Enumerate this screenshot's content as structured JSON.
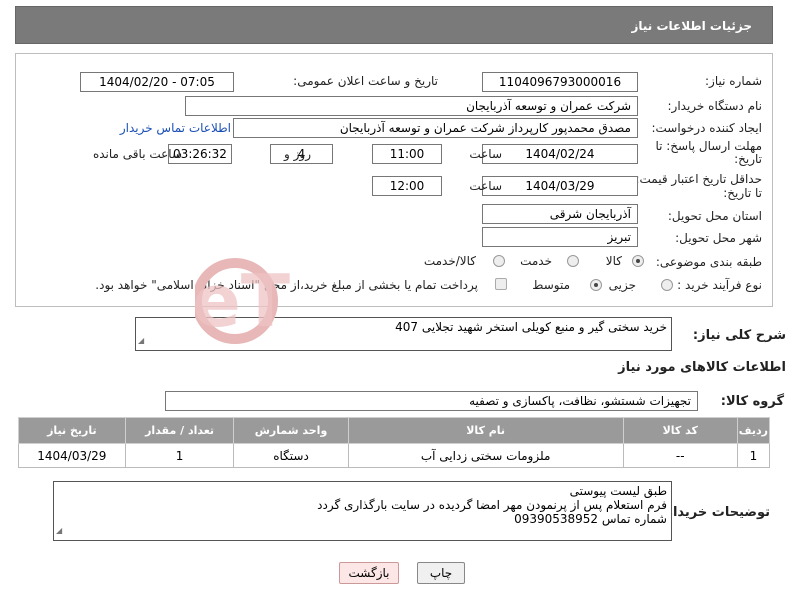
{
  "page_title": "جزئیات اطلاعات نیاز",
  "fields": {
    "need_number_label": "شماره نیاز:",
    "need_number": "1104096793000016",
    "announce_datetime_label": "تاریخ و ساعت اعلان عمومی:",
    "announce_datetime": "1404/02/20 - 07:05",
    "buyer_org_label": "نام دستگاه خریدار:",
    "buyer_org": "شرکت عمران و توسعه آذربایجان",
    "requester_label": "ایجاد کننده درخواست:",
    "requester": "مصدق محمدپور کارپرداز شرکت عمران و توسعه آذربایجان",
    "buyer_contact_link": "اطلاعات تماس خریدار",
    "deadline_label_1": "مهلت ارسال پاسخ: تا",
    "deadline_label_2": "تاریخ:",
    "deadline_date": "1404/02/24",
    "time_word": "ساعت",
    "deadline_time": "11:00",
    "days_remaining": "4",
    "days_word": "روز و",
    "time_remaining": "03:26:32",
    "time_remaining_suffix": "ساعت باقی مانده",
    "validity_label_1": "حداقل تاریخ اعتبار قیمت:",
    "validity_label_2": "تا تاریخ:",
    "validity_date": "1404/03/29",
    "validity_time": "12:00",
    "province_label": "استان محل تحویل:",
    "province": "آذربایجان شرقی",
    "city_label": "شهر محل تحویل:",
    "city": "تبریز",
    "category_label": "طبقه بندی موضوعی:",
    "category_options": [
      "کالا",
      "خدمت",
      "کالا/خدمت"
    ],
    "category_selected": "کالا",
    "process_label": "نوع فرآیند خرید :",
    "process_options": [
      "جزیی",
      "متوسط"
    ],
    "process_selected": "متوسط",
    "payment_note": "پرداخت تمام یا بخشی از مبلغ خرید،از محل \"اسناد خزانه اسلامی\" خواهد بود."
  },
  "description": {
    "label": "شرح کلی نیاز:",
    "text": "خرید سختی گیر و منبع کویلی استخر شهید تجلایی 407"
  },
  "goods_section": {
    "title": "اطلاعات کالاهای مورد نیاز",
    "group_label": "گروه کالا:",
    "group_value": "تجهیزات شستشو، نظافت، پاکسازی و تصفیه"
  },
  "table": {
    "headers": [
      "ردیف",
      "کد کالا",
      "نام کالا",
      "واحد شمارش",
      "تعداد / مقدار",
      "تاریخ نیاز"
    ],
    "rows": [
      [
        "1",
        "--",
        "ملزومات سختی زدایی آب",
        "دستگاه",
        "1",
        "1404/03/29"
      ]
    ]
  },
  "buyer_notes": {
    "label": "توضیحات خریدار:",
    "lines": [
      "طبق لیست پیوستی",
      "فرم استعلام پس از پرنمودن مهر امضا گردیده در سایت بارگذاری گردد",
      "شماره تماس 09390538952"
    ]
  },
  "buttons": {
    "print": "چاپ",
    "back": "بازگشت"
  },
  "watermark_text": "AriaTender.neT",
  "colors": {
    "header_bg": "#7a7a7a",
    "table_header_bg": "#9a9a9a",
    "link": "#1a4fb5",
    "watermark": "#e3aaaa"
  }
}
